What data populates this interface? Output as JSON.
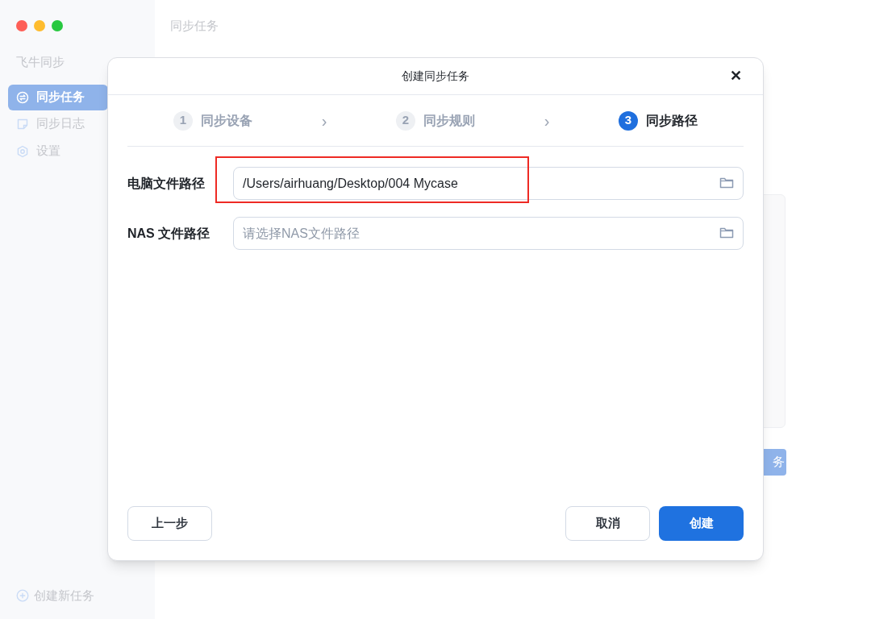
{
  "window": {
    "controls": [
      {
        "color": "#fe5f57"
      },
      {
        "color": "#febc2e"
      },
      {
        "color": "#28c840"
      }
    ]
  },
  "sidebar": {
    "app_name": "飞牛同步",
    "items": [
      {
        "label": "同步任务",
        "selected": true
      },
      {
        "label": "同步日志",
        "selected": false
      },
      {
        "label": "设置",
        "selected": false
      }
    ],
    "new_task": "创建新任务"
  },
  "main": {
    "title": "同步任务",
    "background_button": "务"
  },
  "dialog": {
    "title": "创建同步任务",
    "close": "✕",
    "steps": [
      {
        "number": "1",
        "label": "同步设备",
        "selected": false
      },
      {
        "number": "2",
        "label": "同步规则",
        "selected": false
      },
      {
        "number": "3",
        "label": "同步路径",
        "selected": true
      }
    ],
    "step_separator": "›",
    "fields": [
      {
        "label": "电脑文件路径",
        "value": "/Users/airhuang/Desktop/004 Mycase",
        "highlighted": true
      },
      {
        "label": "NAS 文件路径",
        "placeholder": "请选择NAS文件路径",
        "highlighted": false
      }
    ],
    "buttons": [
      {
        "label": "上一步",
        "kind": "secondary"
      },
      {
        "label": "取消",
        "kind": "secondary"
      },
      {
        "label": "创建",
        "kind": "primary"
      }
    ]
  }
}
